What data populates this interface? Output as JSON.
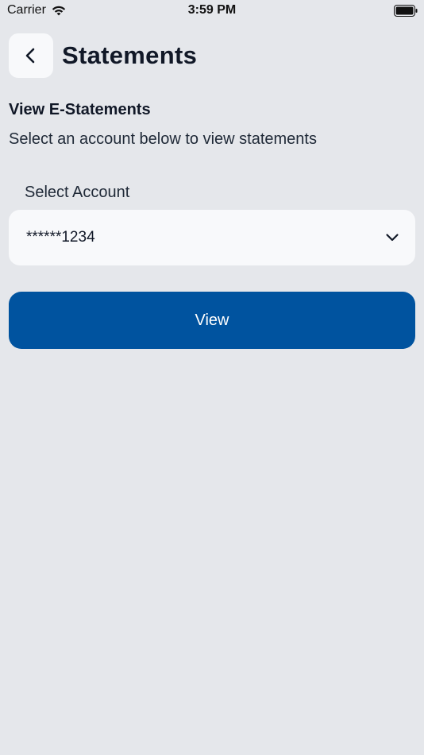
{
  "status_bar": {
    "carrier": "Carrier",
    "time": "3:59 PM",
    "icons": [
      "wifi-icon",
      "battery-icon"
    ]
  },
  "header": {
    "back_icon": "chevron-left-icon",
    "title": "Statements"
  },
  "section": {
    "title": "View E-Statements",
    "subtitle": "Select an account below to view statements"
  },
  "account_select": {
    "label": "Select Account",
    "value": "******1234",
    "icon": "chevron-down-icon"
  },
  "actions": {
    "view_label": "View"
  },
  "colors": {
    "background": "#e5e7eb",
    "card": "#f8f9fb",
    "primary": "#00539f",
    "text": "#111827"
  }
}
